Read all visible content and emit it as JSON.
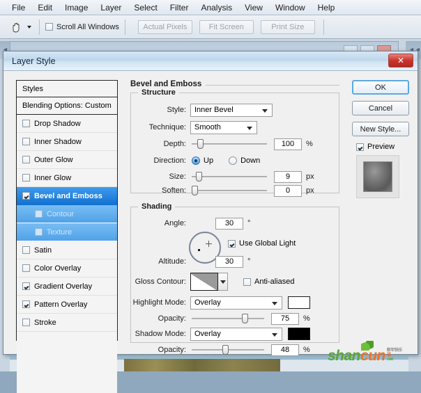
{
  "app": {
    "menus": [
      "File",
      "Edit",
      "Image",
      "Layer",
      "Select",
      "Filter",
      "Analysis",
      "View",
      "Window",
      "Help"
    ],
    "optionbar": {
      "tool_icon": "hand-tool-icon",
      "scroll_all_windows": "Scroll All Windows",
      "scroll_all_windows_checked": false,
      "buttons": [
        "Actual Pixels",
        "Fit Screen",
        "Print Size"
      ]
    }
  },
  "dialog": {
    "title": "Layer Style",
    "close_label": "✕",
    "styles_panel": {
      "header": "Styles",
      "blending_options": "Blending Options: Custom",
      "effects": [
        {
          "label": "Drop Shadow",
          "checked": false,
          "selected": false,
          "sub": false
        },
        {
          "label": "Inner Shadow",
          "checked": false,
          "selected": false,
          "sub": false
        },
        {
          "label": "Outer Glow",
          "checked": false,
          "selected": false,
          "sub": false
        },
        {
          "label": "Inner Glow",
          "checked": false,
          "selected": false,
          "sub": false
        },
        {
          "label": "Bevel and Emboss",
          "checked": true,
          "selected": true,
          "sub": false
        },
        {
          "label": "Contour",
          "checked": false,
          "selected": false,
          "sub": true
        },
        {
          "label": "Texture",
          "checked": false,
          "selected": false,
          "sub": true
        },
        {
          "label": "Satin",
          "checked": false,
          "selected": false,
          "sub": false
        },
        {
          "label": "Color Overlay",
          "checked": false,
          "selected": false,
          "sub": false
        },
        {
          "label": "Gradient Overlay",
          "checked": true,
          "selected": false,
          "sub": false
        },
        {
          "label": "Pattern Overlay",
          "checked": true,
          "selected": false,
          "sub": false
        },
        {
          "label": "Stroke",
          "checked": false,
          "selected": false,
          "sub": false
        }
      ]
    },
    "panel_title": "Bevel and Emboss",
    "structure": {
      "legend": "Structure",
      "style_label": "Style:",
      "style_value": "Inner Bevel",
      "technique_label": "Technique:",
      "technique_value": "Smooth",
      "depth_label": "Depth:",
      "depth_value": "100",
      "depth_unit": "%",
      "direction_label": "Direction:",
      "direction_up": "Up",
      "direction_down": "Down",
      "direction_selected": "Up",
      "size_label": "Size:",
      "size_value": "9",
      "size_unit": "px",
      "soften_label": "Soften:",
      "soften_value": "0",
      "soften_unit": "px"
    },
    "shading": {
      "legend": "Shading",
      "angle_label": "Angle:",
      "angle_value": "30",
      "angle_unit": "°",
      "use_global_light": "Use Global Light",
      "use_global_light_checked": true,
      "altitude_label": "Altitude:",
      "altitude_value": "30",
      "altitude_unit": "°",
      "gloss_contour_label": "Gloss Contour:",
      "anti_aliased": "Anti-aliased",
      "anti_aliased_checked": false,
      "highlight_mode_label": "Highlight Mode:",
      "highlight_mode_value": "Overlay",
      "highlight_color": "#ffffff",
      "highlight_opacity_label": "Opacity:",
      "highlight_opacity_value": "75",
      "highlight_opacity_unit": "%",
      "shadow_mode_label": "Shadow Mode:",
      "shadow_mode_value": "Overlay",
      "shadow_color": "#000000",
      "shadow_opacity_label": "Opacity:",
      "shadow_opacity_value": "48",
      "shadow_opacity_unit": "%"
    },
    "actions": {
      "ok": "OK",
      "cancel": "Cancel",
      "new_style": "New Style...",
      "preview": "Preview",
      "preview_checked": true
    }
  },
  "watermark": {
    "part1": "shan",
    "part2": "cun",
    "tag1": "新年快乐",
    "tag2": "福",
    "tag3": ".net"
  }
}
